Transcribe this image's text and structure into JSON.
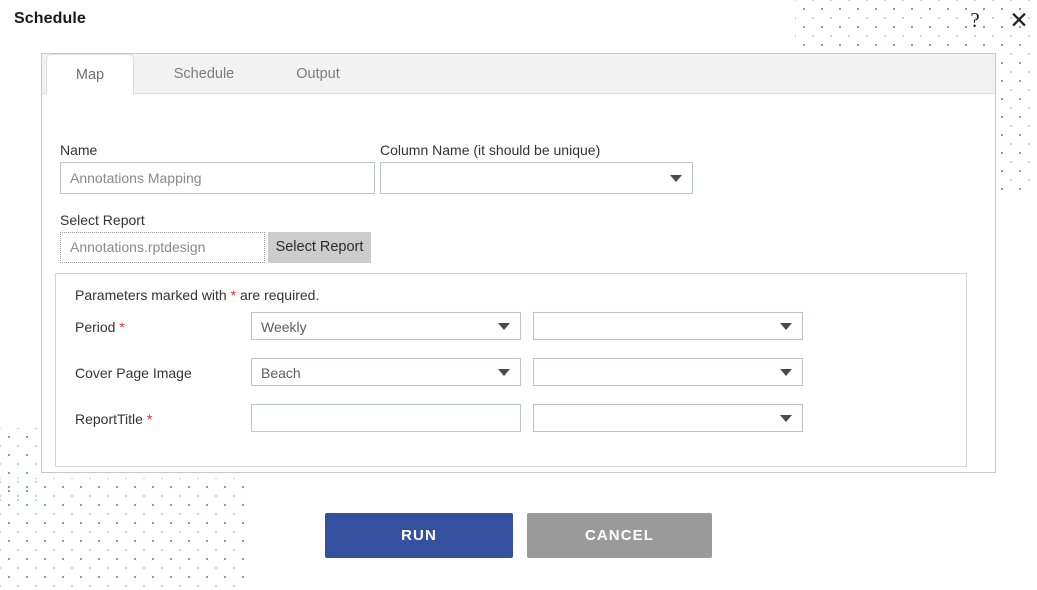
{
  "header": {
    "title": "Schedule",
    "help_icon": "question-mark-icon",
    "help_glyph": "?",
    "close_icon": "close-x-icon",
    "close_glyph": "✕"
  },
  "tabs": [
    {
      "label": "Map",
      "active": true
    },
    {
      "label": "Schedule",
      "active": false
    },
    {
      "label": "Output",
      "active": false
    }
  ],
  "form": {
    "name": {
      "label": "Name",
      "value": "Annotations Mapping"
    },
    "column_name": {
      "label": "Column Name (it should be unique)",
      "value": ""
    },
    "select_report": {
      "label": "Select Report",
      "file_value": "Annotations.rptdesign",
      "button_label": "Select Report"
    }
  },
  "parameters": {
    "note_prefix": "Parameters marked with ",
    "note_star": "*",
    "note_suffix": " are required.",
    "rows": [
      {
        "label": "Period",
        "required": true,
        "required_star": "*",
        "control_type": "select",
        "value": "Weekly",
        "aux_type": "select",
        "aux_value": ""
      },
      {
        "label": "Cover Page Image",
        "required": false,
        "required_star": "",
        "control_type": "select",
        "value": "Beach",
        "aux_type": "select",
        "aux_value": ""
      },
      {
        "label": "ReportTitle",
        "required": true,
        "required_star": "*",
        "control_type": "text",
        "value": "",
        "aux_type": "select",
        "aux_value": ""
      }
    ]
  },
  "actions": {
    "run_label": "RUN",
    "cancel_label": "CANCEL"
  },
  "colors": {
    "run_button": "#35509f",
    "cancel_button": "#9a9a9a",
    "required_star": "#e03131",
    "select_report_button": "#cccccc",
    "tab_bar_background": "#f2f2f2",
    "dot_pattern": "#8b95d6"
  }
}
